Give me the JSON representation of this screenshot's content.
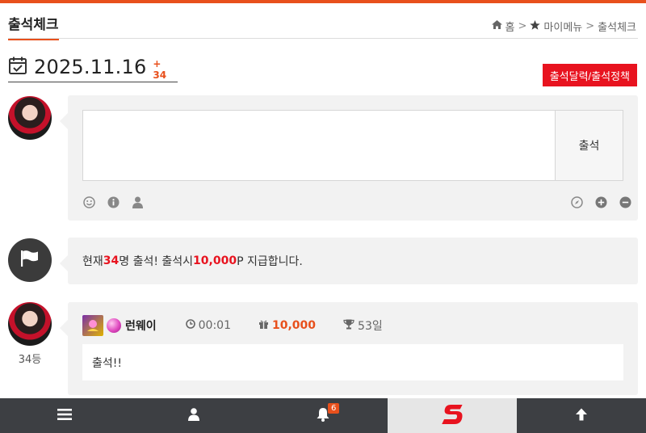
{
  "header": {
    "title": "출석체크",
    "breadcrumb": {
      "home": "홈",
      "sep1": ">",
      "menu": "마이메뉴",
      "sep2": ">",
      "current": "출석체크"
    }
  },
  "date_bar": {
    "date": "2025.11.16",
    "count": "+ 34"
  },
  "policy_button": "출석달력/출석정책",
  "comment_form": {
    "textarea_value": "",
    "submit_label": "출석"
  },
  "notice": {
    "prefix": "현재 ",
    "count": "34",
    "mid": "명 출석! 출석시 ",
    "points": "10,000",
    "suffix": "P 지급합니다."
  },
  "entry": {
    "nickname": "런웨이",
    "time": "00:01",
    "points": "10,000",
    "days": "53일",
    "message": "출석!!",
    "rank": "34등"
  },
  "bottom_nav": {
    "alerts_badge": "6"
  },
  "colors": {
    "accent": "#e8501c",
    "red": "#e8131f",
    "nav_bg": "#3d3f43"
  }
}
